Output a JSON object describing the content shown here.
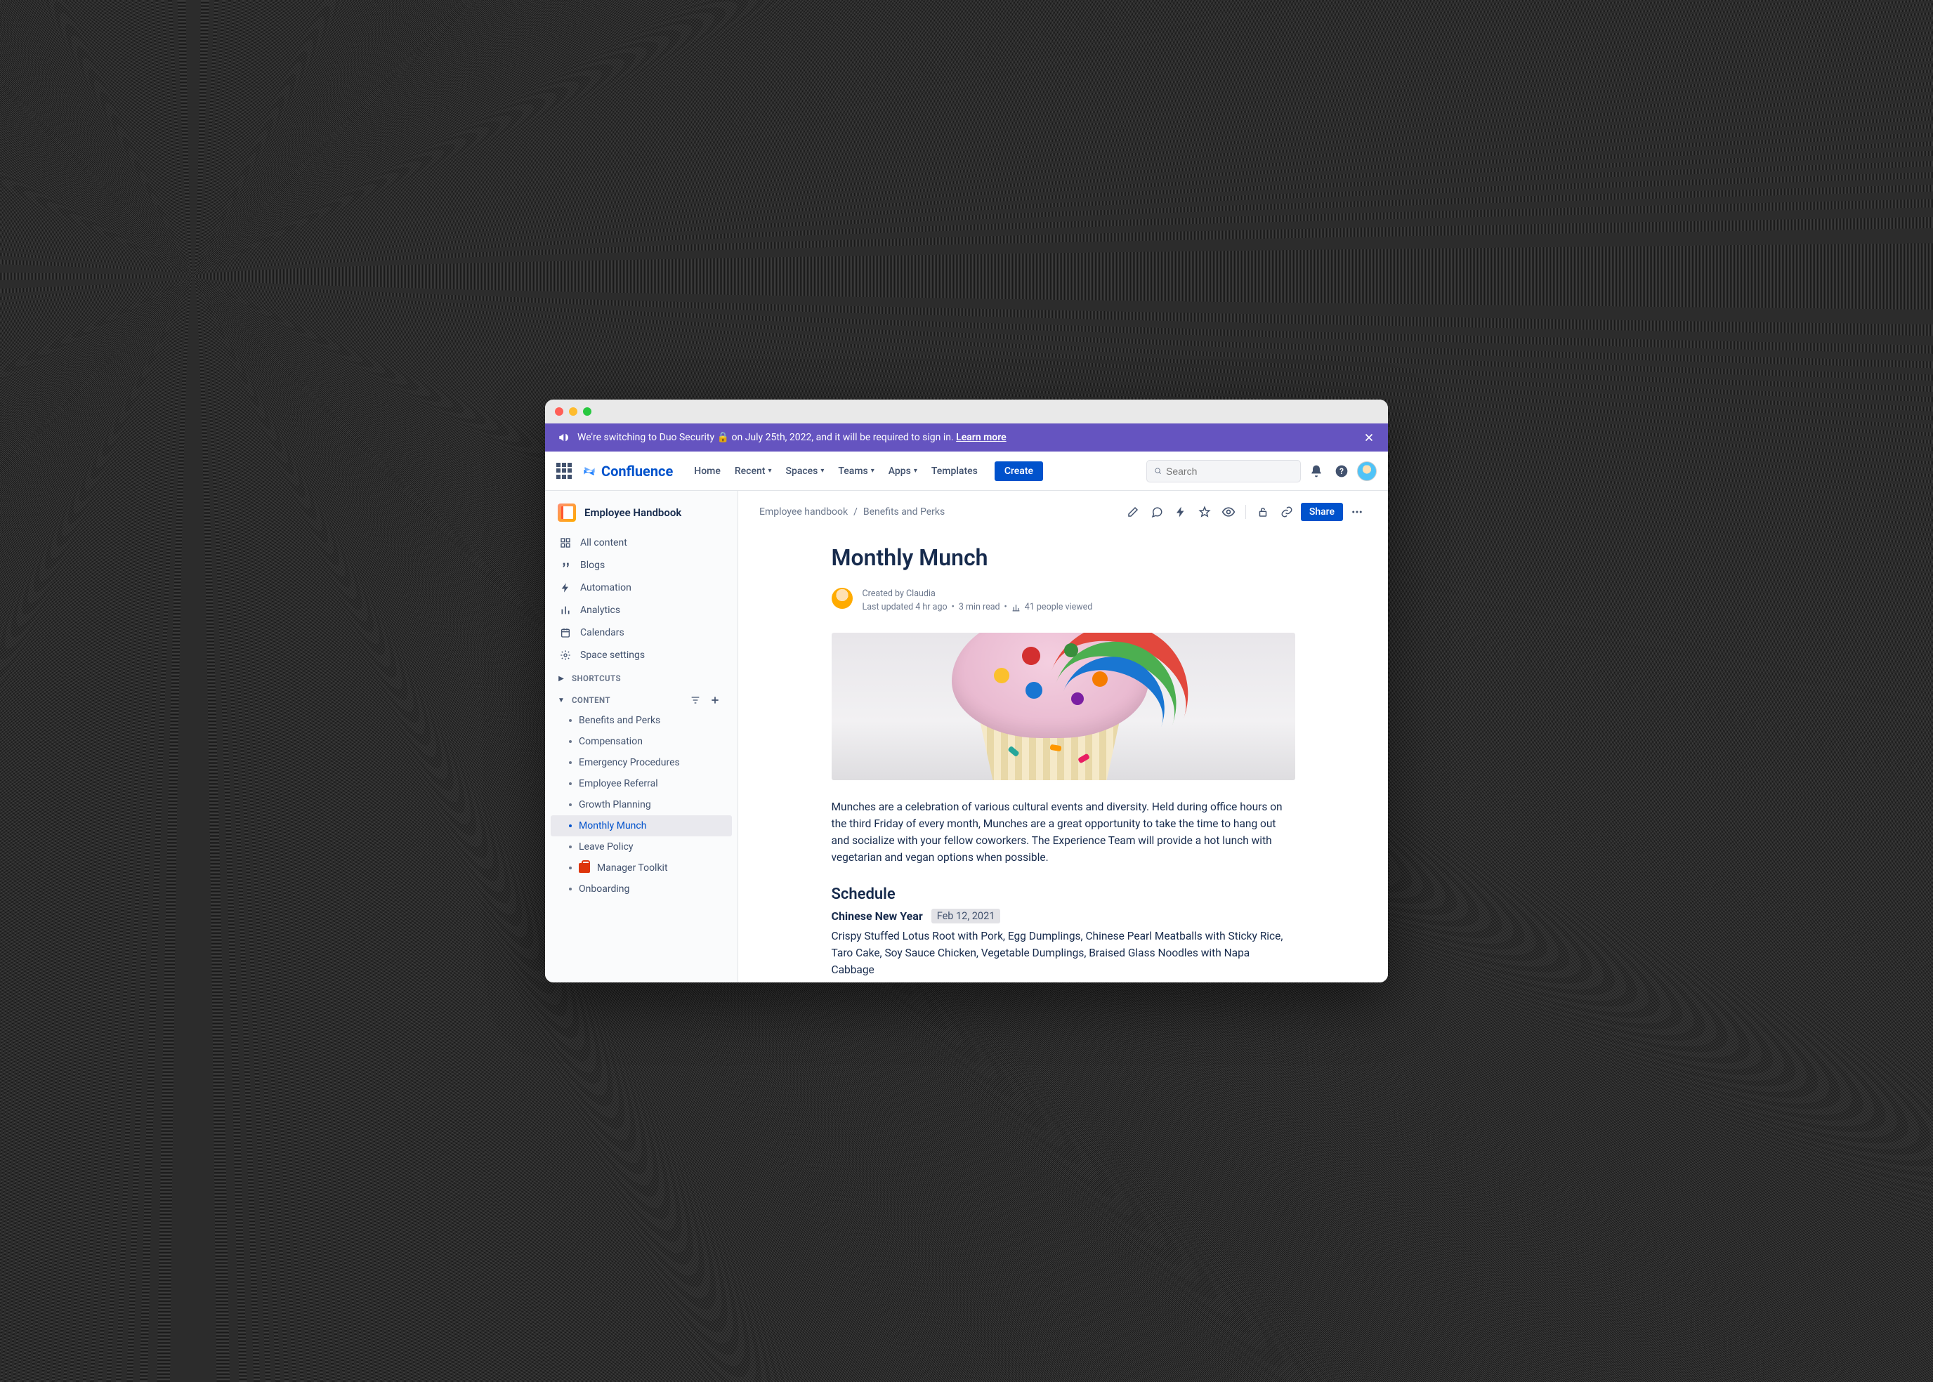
{
  "banner": {
    "text_prefix": "We're switching to Duo Security ",
    "lock": "🔒",
    "text_suffix": " on July 25th, 2022, and it will be required to sign in. ",
    "learn_more": "Learn more"
  },
  "topnav": {
    "product": "Confluence",
    "items": [
      {
        "label": "Home",
        "dropdown": false
      },
      {
        "label": "Recent",
        "dropdown": true
      },
      {
        "label": "Spaces",
        "dropdown": true
      },
      {
        "label": "Teams",
        "dropdown": true
      },
      {
        "label": "Apps",
        "dropdown": true
      },
      {
        "label": "Templates",
        "dropdown": false
      }
    ],
    "create": "Create",
    "search_placeholder": "Search"
  },
  "sidebar": {
    "space": "Employee Handbook",
    "nav": [
      {
        "icon": "grid",
        "label": "All content"
      },
      {
        "icon": "quote",
        "label": "Blogs"
      },
      {
        "icon": "bolt",
        "label": "Automation"
      },
      {
        "icon": "bars",
        "label": "Analytics"
      },
      {
        "icon": "calendar",
        "label": "Calendars"
      },
      {
        "icon": "gear",
        "label": "Space settings"
      }
    ],
    "shortcuts_label": "SHORTCUTS",
    "content_label": "CONTENT",
    "content_tree": [
      {
        "label": "Benefits and Perks",
        "active": false
      },
      {
        "label": "Compensation",
        "active": false
      },
      {
        "label": "Emergency Procedures",
        "active": false
      },
      {
        "label": "Employee Referral",
        "active": false
      },
      {
        "label": "Growth Planning",
        "active": false
      },
      {
        "label": "Monthly Munch",
        "active": true
      },
      {
        "label": "Leave Policy",
        "active": false
      },
      {
        "label": "Manager Toolkit",
        "active": false,
        "toolkit": true
      },
      {
        "label": "Onboarding",
        "active": false
      }
    ]
  },
  "breadcrumb": {
    "parts": [
      "Employee handbook",
      "Benefits and Perks"
    ]
  },
  "page_actions": {
    "share": "Share"
  },
  "page": {
    "title": "Monthly Munch",
    "created_prefix": "Created by ",
    "author": "Claudia",
    "updated": "Last updated  4 hr ago",
    "read": "3 min read",
    "views": "41 people viewed",
    "intro": "Munches are a celebration of various cultural events and diversity. Held during office hours on the third Friday of every month, Munches are a great opportunity to take the time to hang out and socialize with your fellow coworkers. The Experience Team will provide a hot lunch with vegetarian and vegan options when possible.",
    "schedule_heading": "Schedule",
    "events": [
      {
        "title": "Chinese New Year",
        "date": "Feb 12, 2021",
        "menu": "Crispy Stuffed Lotus Root with Pork, Egg Dumplings, Chinese Pearl Meatballs with Sticky Rice, Taro Cake, Soy Sauce Chicken, Vegetable Dumplings, Braised Glass Noodles with Napa Cabbage"
      }
    ]
  }
}
